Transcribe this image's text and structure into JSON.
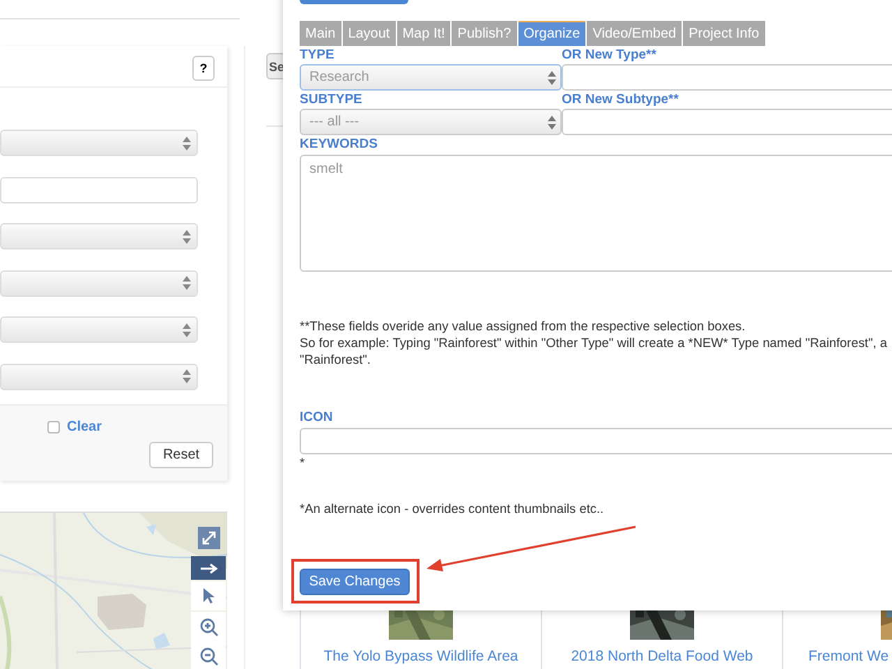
{
  "filters": {
    "help_button": "?",
    "clear_checkbox": {
      "label": "Clear",
      "checked": false
    },
    "reset_button": "Reset"
  },
  "search_button": "Se",
  "cards": [
    {
      "title": "The Yolo Bypass Wildlife Area"
    },
    {
      "title": "2018 North Delta Food Web"
    },
    {
      "title": "Fremont We"
    }
  ],
  "modal": {
    "tabs": [
      {
        "label": "Main",
        "selected": false
      },
      {
        "label": "Layout",
        "selected": false
      },
      {
        "label": "Map It!",
        "selected": false
      },
      {
        "label": "Publish?",
        "selected": false
      },
      {
        "label": "Organize",
        "selected": true
      },
      {
        "label": "Video/Embed",
        "selected": false
      },
      {
        "label": "Project Info",
        "selected": false
      }
    ],
    "type": {
      "label": "TYPE",
      "value": "Research"
    },
    "new_type": {
      "label": "OR New Type**"
    },
    "subtype": {
      "label": "SUBTYPE",
      "value": "--- all ---"
    },
    "new_subtype": {
      "label": "OR New Subtype**"
    },
    "keywords": {
      "label": "KEYWORDS",
      "value": "smelt"
    },
    "notes": [
      "**These fields overide any value assigned from the respective selection boxes.",
      "So for example: Typing \"Rainforest\" within \"Other Type\" will create a *NEW* Type named \"Rainforest\", a",
      "\"Rainforest\"."
    ],
    "icon": {
      "label": "ICON",
      "hint": "*"
    },
    "icon_note": "*An alternate icon - overrides content thumbnails etc..",
    "save_button": "Save Changes"
  }
}
